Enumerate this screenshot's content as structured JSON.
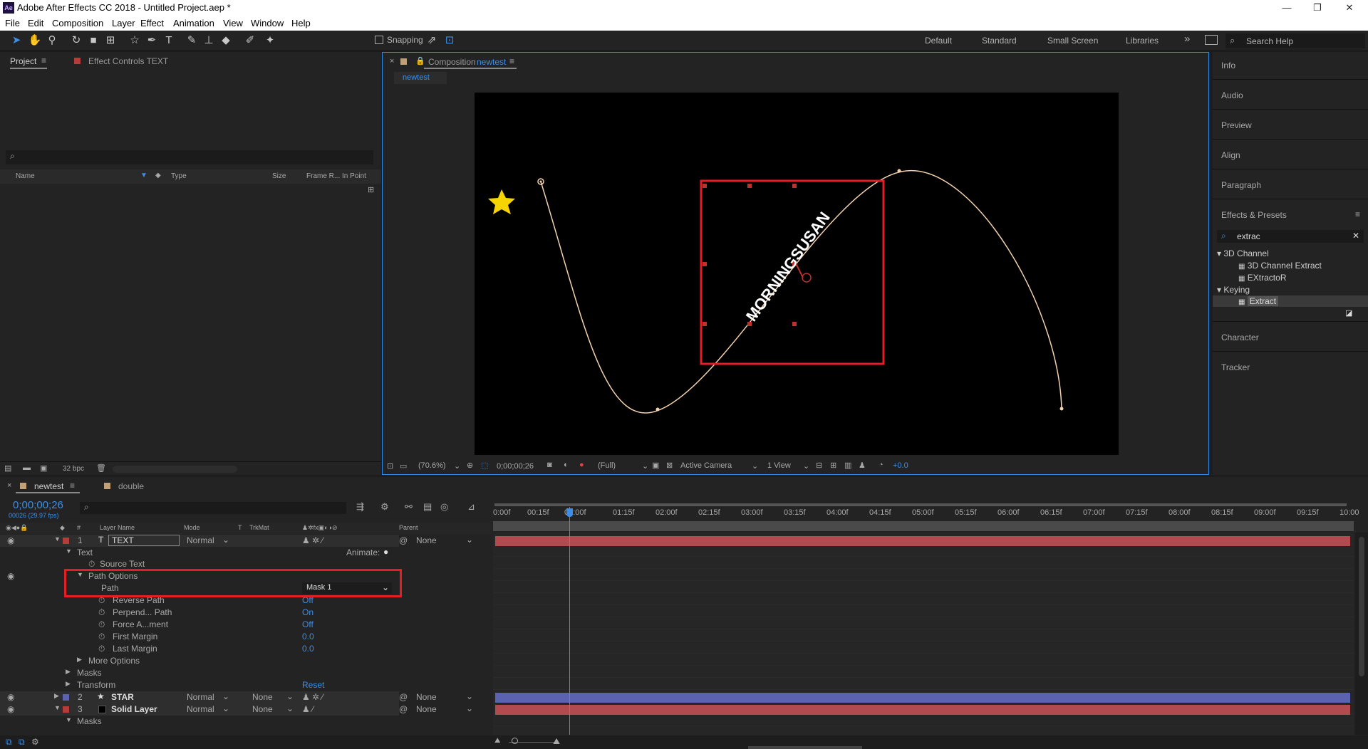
{
  "app": {
    "logo": "Ae",
    "title": "Adobe After Effects CC 2018 - Untitled Project.aep *",
    "win_min": "—",
    "win_max": "❐",
    "win_close": "✕"
  },
  "menu": [
    "File",
    "Edit",
    "Composition",
    "Layer",
    "Effect",
    "Animation",
    "View",
    "Window",
    "Help"
  ],
  "toolbar": {
    "snapping": "Snapping",
    "workspaces": [
      "Default",
      "Standard",
      "Small Screen",
      "Libraries"
    ],
    "more": "»",
    "search": "Search Help"
  },
  "project": {
    "tab": "Project",
    "effect_controls": "Effect Controls TEXT",
    "search_icon": "⌕",
    "cols": [
      "Name",
      "Type",
      "Size",
      "Frame R...",
      "In Point"
    ],
    "bpc": "32 bpc"
  },
  "comp": {
    "tab_prefix": "Composition",
    "tab_name": "newtest",
    "sub": "newtest",
    "text": "MORNINGSUSAN",
    "zoom": "(70.6%)",
    "time": "0;00;00;26",
    "res": "(Full)",
    "camera": "Active Camera",
    "view": "1 View",
    "exposure": "+0.0"
  },
  "right": {
    "items": [
      "Info",
      "Audio",
      "Preview",
      "Align",
      "Paragraph"
    ],
    "effects": "Effects & Presets",
    "search": "extrac",
    "tree": [
      "3D Channel",
      "3D Channel Extract",
      "EXtractoR",
      "Keying",
      "Extract"
    ],
    "bottom": [
      "Character",
      "Tracker"
    ]
  },
  "timeline": {
    "tab1": "newtest",
    "tab2": "double",
    "time": "0;00;00;26",
    "fps": "00026 (29.97 fps)",
    "headers": [
      "#",
      "Layer Name",
      "Mode",
      "T",
      "TrkMat",
      "Parent"
    ],
    "ruler": [
      "0:00f",
      "00:15f",
      "01:00f",
      "01:15f",
      "02:00f",
      "02:15f",
      "03:00f",
      "03:15f",
      "04:00f",
      "04:15f",
      "05:00f",
      "05:15f",
      "06:00f",
      "06:15f",
      "07:00f",
      "07:15f",
      "08:00f",
      "08:15f",
      "09:00f",
      "09:15f",
      "10:00"
    ],
    "rows": {
      "l1_num": "1",
      "l1_name": "TEXT",
      "l1_mode": "Normal",
      "l1_parent": "None",
      "text": "Text",
      "animate": "Animate:",
      "source_text": "Source Text",
      "path_options": "Path Options",
      "path": "Path",
      "path_val": "Mask 1",
      "reverse": "Reverse Path",
      "reverse_v": "Off",
      "perp": "Perpend... Path",
      "perp_v": "On",
      "force": "Force A...ment",
      "force_v": "Off",
      "first": "First Margin",
      "first_v": "0.0",
      "last": "Last Margin",
      "last_v": "0.0",
      "more": "More Options",
      "masks": "Masks",
      "transform": "Transform",
      "reset": "Reset",
      "l2_num": "2",
      "l2_name": "STAR",
      "l2_mode": "Normal",
      "l2_trk": "None",
      "l2_parent": "None",
      "l3_num": "3",
      "l3_name": "Solid Layer",
      "l3_mode": "Normal",
      "l3_trk": "None",
      "l3_parent": "None",
      "masks2": "Masks"
    }
  },
  "colors": {
    "accent": "#3d8ee6",
    "highlight": "#e31e24",
    "layer_red": "#b14b50",
    "layer_blue": "#5b63b0"
  }
}
